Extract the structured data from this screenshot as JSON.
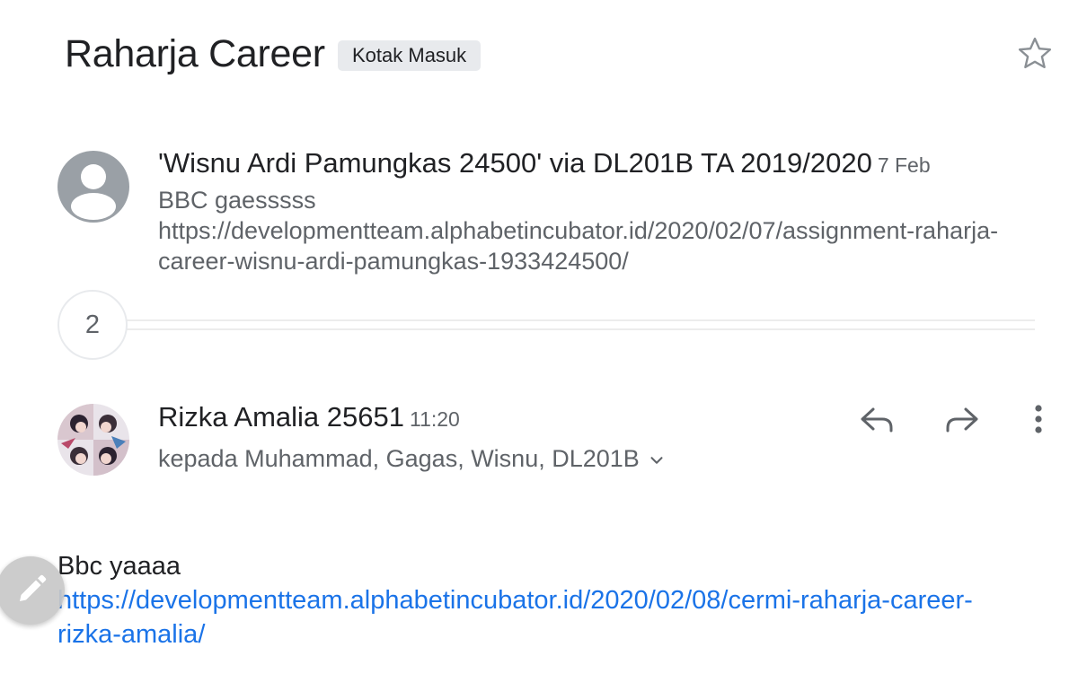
{
  "header": {
    "subject": "Raharja Career",
    "label": "Kotak Masuk"
  },
  "thread": {
    "first_message": {
      "sender": "'Wisnu Ardi Pamungkas 24500' via DL201B TA 2019/2020",
      "date": "7 Feb",
      "snippet": "BBC gaesssss https://developmentteam.alphabetincubator.id/2020/02/07/assignment-raharja-career-wisnu-ardi-pamungkas-1933424500/"
    },
    "collapsed_count": "2",
    "latest_message": {
      "sender": "Rizka Amalia 25651",
      "time": "11:20",
      "recipients": "kepada Muhammad, Gagas, Wisnu, DL201B",
      "body_text": "Bbc yaaaa",
      "link": "https://developmentteam.alphabetincubator.id/2020/02/08/cermi-raharja-career-rizka-amalia/"
    }
  },
  "icons": {
    "star": "star-outline-icon",
    "reply": "reply-icon",
    "forward": "forward-icon",
    "more": "more-vert-icon",
    "compose": "pencil-icon"
  },
  "colors": {
    "link": "#1a73e8",
    "secondary_text": "#5f6368",
    "chip_background": "#e8eaed"
  }
}
